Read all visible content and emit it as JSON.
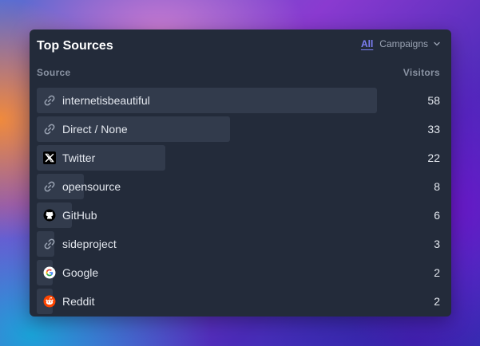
{
  "card": {
    "title": "Top Sources",
    "filters": {
      "all_label": "All",
      "campaigns_label": "Campaigns"
    },
    "columns": {
      "source": "Source",
      "visitors": "Visitors"
    },
    "rows": [
      {
        "label": "internetisbeautiful",
        "value": "58",
        "fraction": 1.0,
        "icon": "link-icon"
      },
      {
        "label": "Direct / None",
        "value": "33",
        "fraction": 0.569,
        "icon": "link-icon"
      },
      {
        "label": "Twitter",
        "value": "22",
        "fraction": 0.379,
        "icon": "x-twitter-icon"
      },
      {
        "label": "opensource",
        "value": "8",
        "fraction": 0.138,
        "icon": "link-icon"
      },
      {
        "label": "GitHub",
        "value": "6",
        "fraction": 0.103,
        "icon": "github-icon"
      },
      {
        "label": "sideproject",
        "value": "3",
        "fraction": 0.052,
        "icon": "link-icon"
      },
      {
        "label": "Google",
        "value": "2",
        "fraction": 0.034,
        "icon": "google-icon"
      },
      {
        "label": "Reddit",
        "value": "2",
        "fraction": 0.034,
        "icon": "reddit-icon"
      }
    ]
  },
  "colors": {
    "card_bg": "#232b3a",
    "bar_bg": "#323b4c",
    "accent": "#7d7ff5",
    "muted": "#8a93a3"
  }
}
